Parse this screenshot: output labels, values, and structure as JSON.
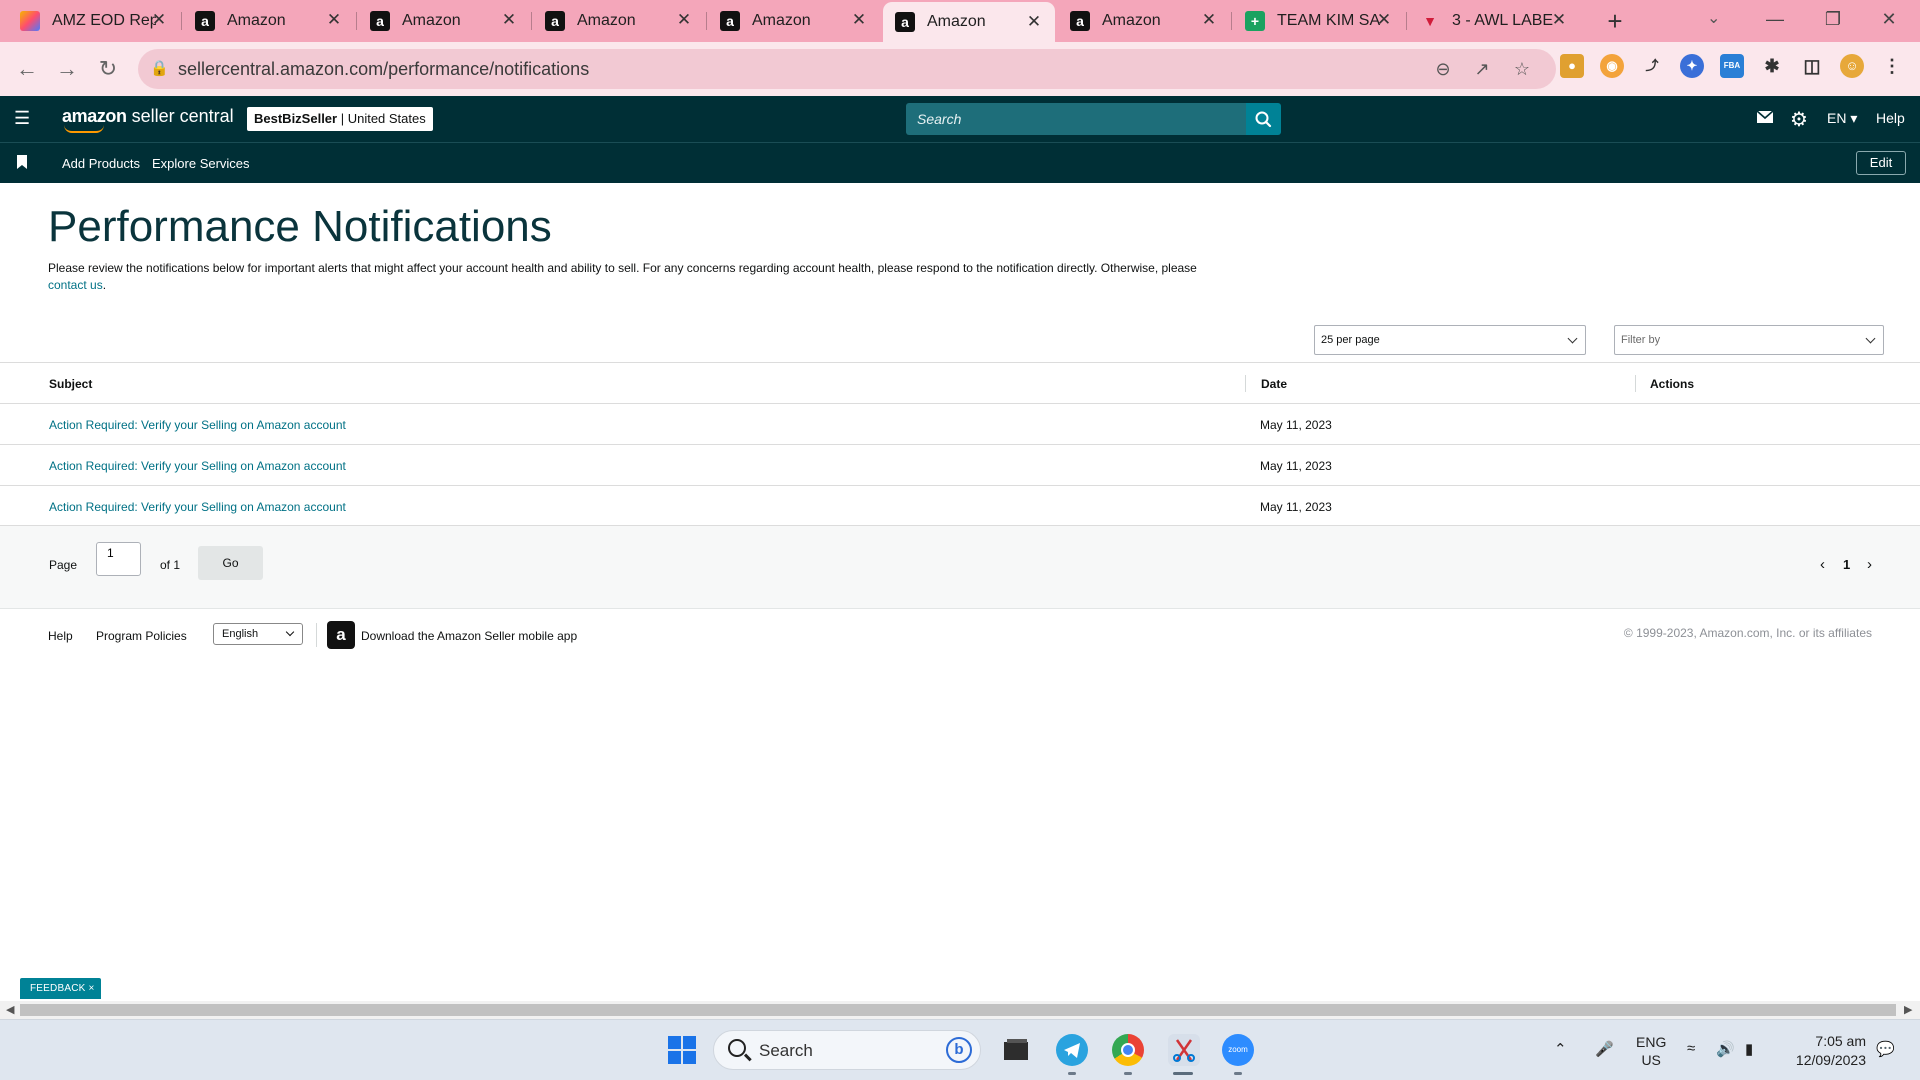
{
  "browser": {
    "tabs": [
      {
        "title": "AMZ EOD Rep",
        "favicon": "amz-eod-icon",
        "active": false
      },
      {
        "title": "Amazon",
        "favicon": "amazon-icon",
        "active": false
      },
      {
        "title": "Amazon",
        "favicon": "amazon-icon",
        "active": false
      },
      {
        "title": "Amazon",
        "favicon": "amazon-icon",
        "active": false
      },
      {
        "title": "Amazon",
        "favicon": "amazon-icon",
        "active": false
      },
      {
        "title": "Amazon",
        "favicon": "amazon-icon",
        "active": true
      },
      {
        "title": "Amazon",
        "favicon": "amazon-icon",
        "active": false
      },
      {
        "title": "TEAM KIM SA",
        "favicon": "sheets-icon",
        "active": false
      },
      {
        "title": "3 - AWL LABE",
        "favicon": "awl-icon",
        "active": false
      }
    ],
    "url": "sellercentral.amazon.com/performance/notifications",
    "theme_color": "#f4a6ba"
  },
  "header": {
    "logo_text": "amazon",
    "logo_suffix": " seller central",
    "account_name": "BestBizSeller",
    "account_region": " | United States",
    "search_placeholder": "Search",
    "language": "EN",
    "help": "Help",
    "nav_links": [
      "Add Products",
      "Explore Services"
    ],
    "edit": "Edit",
    "brand_color": "#002f36"
  },
  "page": {
    "title": "Performance Notifications",
    "description": "Please review the notifications below for important alerts that might affect your account health and ability to sell. For any concerns regarding account health, please respond to the notification directly. Otherwise, please",
    "contact_link": "contact us",
    "per_page": "25 per page",
    "filter_placeholder": "Filter by"
  },
  "table": {
    "columns": {
      "subject": "Subject",
      "date": "Date",
      "actions": "Actions"
    },
    "rows": [
      {
        "subject": "Action Required: Verify your Selling on Amazon account",
        "date": "May 11, 2023"
      },
      {
        "subject": "Action Required: Verify your Selling on Amazon account",
        "date": "May 11, 2023"
      },
      {
        "subject": "Action Required: Verify your Selling on Amazon account",
        "date": "May 11, 2023"
      }
    ]
  },
  "pagination": {
    "page_label": "Page",
    "page_value": "1",
    "of_label": "of 1",
    "go": "Go",
    "current": "1"
  },
  "footer": {
    "help": "Help",
    "policies": "Program Policies",
    "language": "English",
    "app_text": "Download the Amazon Seller mobile app",
    "copyright": "© 1999-2023, Amazon.com, Inc. or its affiliates"
  },
  "feedback": "FEEDBACK ×",
  "taskbar": {
    "search_placeholder": "Search",
    "lang_top": "ENG",
    "lang_bottom": "US",
    "time": "7:05 am",
    "date": "12/09/2023"
  }
}
